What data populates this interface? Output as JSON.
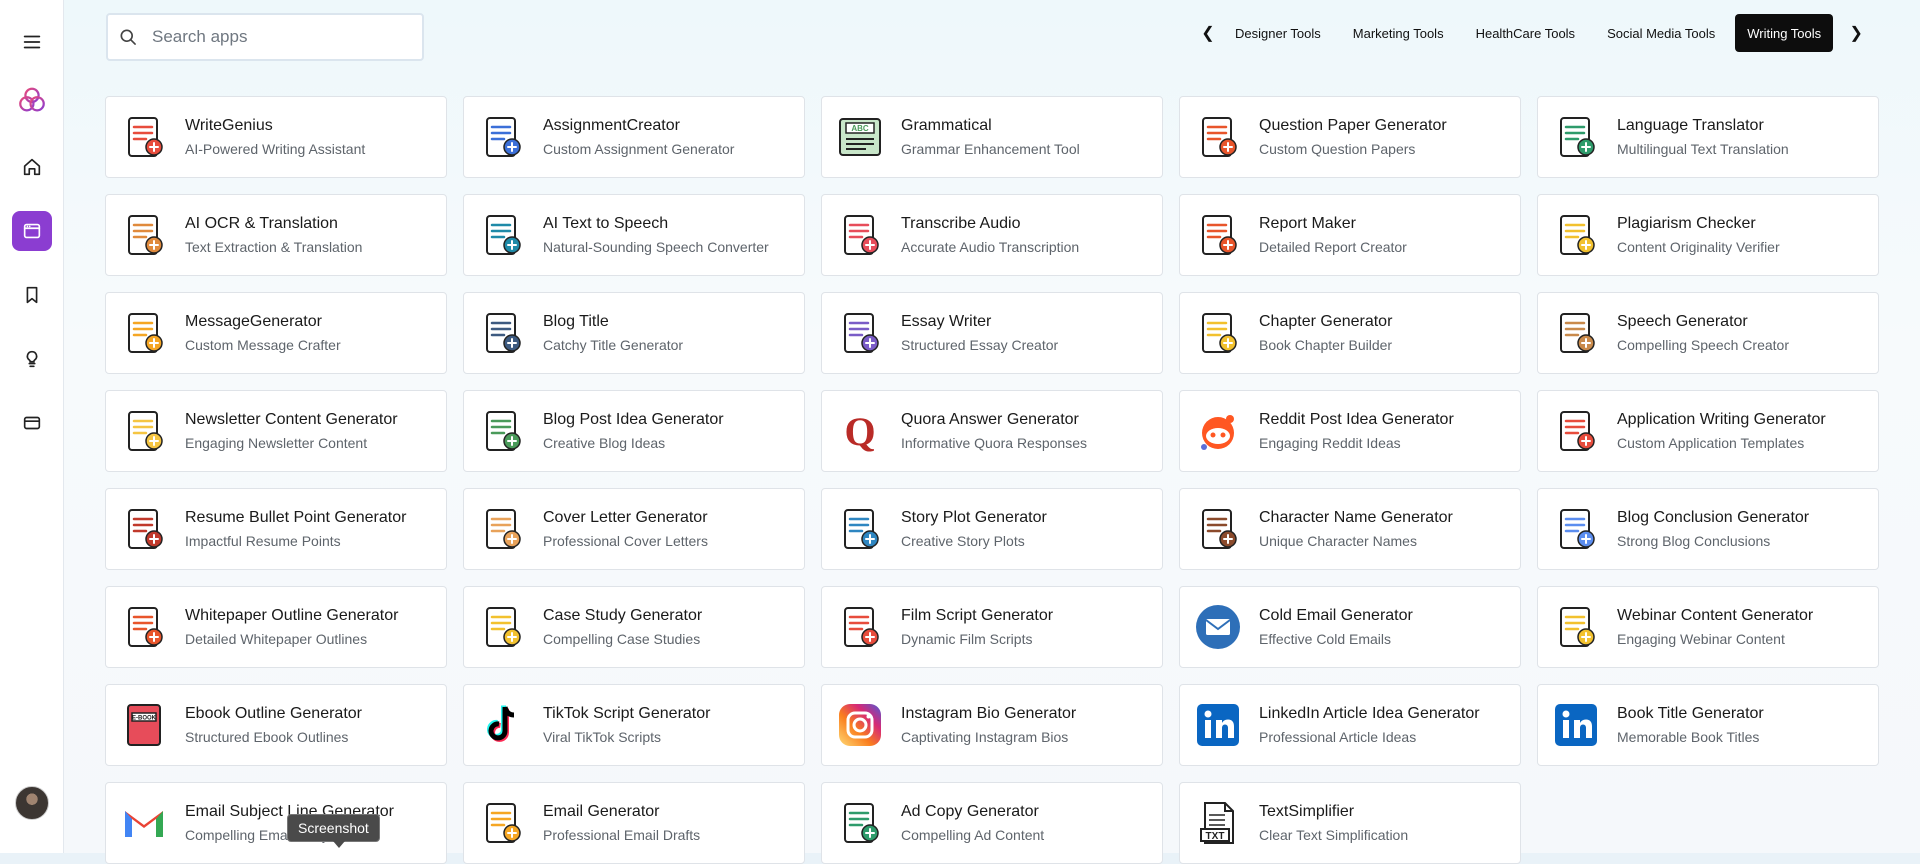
{
  "search": {
    "placeholder": "Search apps",
    "value": ""
  },
  "tabs": [
    {
      "label": "Designer Tools",
      "active": false
    },
    {
      "label": "Marketing Tools",
      "active": false
    },
    {
      "label": "HealthCare Tools",
      "active": false
    },
    {
      "label": "Social Media Tools",
      "active": false
    },
    {
      "label": "Writing Tools",
      "active": true
    }
  ],
  "sidebar": {
    "items": [
      {
        "icon": "menu-icon"
      },
      {
        "icon": "logo-icon"
      },
      {
        "icon": "home-icon"
      },
      {
        "icon": "apps-icon",
        "active": true
      },
      {
        "icon": "bookmark-icon"
      },
      {
        "icon": "lightbulb-icon"
      },
      {
        "icon": "card-icon"
      }
    ],
    "accent": "#8b3dd1"
  },
  "apps": [
    {
      "name": "WriteGenius",
      "desc": "AI-Powered Writing Assistant",
      "icon": "writer-icon",
      "color": "#e74c3c"
    },
    {
      "name": "AssignmentCreator",
      "desc": "Custom Assignment Generator",
      "icon": "student-icon",
      "color": "#3b6fd8"
    },
    {
      "name": "Grammatical",
      "desc": "Grammar Enhancement Tool",
      "icon": "abc-book-icon",
      "color": "#4a9a5a"
    },
    {
      "name": "Question Paper Generator",
      "desc": "Custom Question Papers",
      "icon": "exam-icon",
      "color": "#e8552b"
    },
    {
      "name": "Language Translator",
      "desc": "Multilingual Text Translation",
      "icon": "translate-globe-icon",
      "color": "#2e9b6b"
    },
    {
      "name": "AI OCR & Translation",
      "desc": "Text Extraction & Translation",
      "icon": "image-stack-icon",
      "color": "#e08a3c"
    },
    {
      "name": "AI Text to Speech",
      "desc": "Natural-Sounding Speech Converter",
      "icon": "audio-doc-icon",
      "color": "#1e8aa8"
    },
    {
      "name": "Transcribe Audio",
      "desc": "Accurate Audio Transcription",
      "icon": "translate-letters-icon",
      "color": "#e74c5a"
    },
    {
      "name": "Report Maker",
      "desc": "Detailed Report Creator",
      "icon": "report-chart-icon",
      "color": "#e8552b"
    },
    {
      "name": "Plagiarism Checker",
      "desc": "Content Originality Verifier",
      "icon": "plagiarism-icon",
      "color": "#f2c12e"
    },
    {
      "name": "MessageGenerator",
      "desc": "Custom Message Crafter",
      "icon": "message-alert-icon",
      "color": "#f5a623"
    },
    {
      "name": "Blog Title",
      "desc": "Catchy Title Generator",
      "icon": "blog-page-icon",
      "color": "#3d5a80"
    },
    {
      "name": "Essay Writer",
      "desc": "Structured Essay Creator",
      "icon": "essay-icon",
      "color": "#7a5cc7"
    },
    {
      "name": "Chapter Generator",
      "desc": "Book Chapter Builder",
      "icon": "chapter-list-icon",
      "color": "#f2c12e"
    },
    {
      "name": "Speech Generator",
      "desc": "Compelling Speech Creator",
      "icon": "podium-icon",
      "color": "#c98a4b"
    },
    {
      "name": "Newsletter Content Generator",
      "desc": "Engaging Newsletter Content",
      "icon": "newsletter-icon",
      "color": "#f5c542"
    },
    {
      "name": "Blog Post Idea Generator",
      "desc": "Creative Blog Ideas",
      "icon": "blog-screen-icon",
      "color": "#4a9a5a"
    },
    {
      "name": "Quora Answer Generator",
      "desc": "Informative Quora Responses",
      "icon": "quora-icon",
      "color": "#b92b27"
    },
    {
      "name": "Reddit Post Idea Generator",
      "desc": "Engaging Reddit Ideas",
      "icon": "reddit-icon",
      "color": "#ff5722"
    },
    {
      "name": "Application Writing Generator",
      "desc": "Custom Application Templates",
      "icon": "application-icon",
      "color": "#e74c3c"
    },
    {
      "name": "Resume Bullet Point Generator",
      "desc": "Impactful Resume Points",
      "icon": "resume-icon",
      "color": "#c0392b"
    },
    {
      "name": "Cover Letter Generator",
      "desc": "Professional Cover Letters",
      "icon": "cover-letter-icon",
      "color": "#e8a25a"
    },
    {
      "name": "Story Plot Generator",
      "desc": "Creative Story Plots",
      "icon": "open-book-icon",
      "color": "#2e86c1"
    },
    {
      "name": "Character Name Generator",
      "desc": "Unique Character Names",
      "icon": "bearded-man-icon",
      "color": "#8b4a2b"
    },
    {
      "name": "Blog Conclusion Generator",
      "desc": "Strong Blog Conclusions",
      "icon": "blog-conclusion-icon",
      "color": "#5b8def"
    },
    {
      "name": "Whitepaper Outline Generator",
      "desc": "Detailed Whitepaper Outlines",
      "icon": "pencil-scribble-icon",
      "color": "#e8552b"
    },
    {
      "name": "Case Study Generator",
      "desc": "Compelling Case Studies",
      "icon": "case-study-icon",
      "color": "#f2c12e"
    },
    {
      "name": "Film Script Generator",
      "desc": "Dynamic Film Scripts",
      "icon": "film-script-icon",
      "color": "#e74c3c"
    },
    {
      "name": "Cold Email Generator",
      "desc": "Effective Cold Emails",
      "icon": "envelope-circle-icon",
      "color": "#2e6fb8"
    },
    {
      "name": "Webinar Content Generator",
      "desc": "Engaging Webinar Content",
      "icon": "webinar-icon",
      "color": "#f2c12e"
    },
    {
      "name": "Ebook Outline Generator",
      "desc": "Structured Ebook Outlines",
      "icon": "ebook-icon",
      "color": "#e74c5a"
    },
    {
      "name": "TikTok Script Generator",
      "desc": "Viral TikTok Scripts",
      "icon": "tiktok-icon",
      "color": "#000000"
    },
    {
      "name": "Instagram Bio Generator",
      "desc": "Captivating Instagram Bios",
      "icon": "instagram-icon",
      "color": "#e1306c"
    },
    {
      "name": "LinkedIn Article Idea Generator",
      "desc": "Professional Article Ideas",
      "icon": "linkedin-icon",
      "color": "#0a66c2"
    },
    {
      "name": "Book Title Generator",
      "desc": "Memorable Book Titles",
      "icon": "linkedin-icon",
      "color": "#0a66c2"
    },
    {
      "name": "Email Subject Line Generator",
      "desc": "Compelling Email Subjects",
      "icon": "gmail-icon",
      "color": "#ea4335"
    },
    {
      "name": "Email Generator",
      "desc": "Professional Email Drafts",
      "icon": "paper-plane-mail-icon",
      "color": "#f5a623"
    },
    {
      "name": "Ad Copy Generator",
      "desc": "Compelling Ad Content",
      "icon": "shield-clipboard-icon",
      "color": "#2e9b6b"
    },
    {
      "name": "TextSimplifier",
      "desc": "Clear Text Simplification",
      "icon": "txt-file-icon",
      "color": "#222222"
    }
  ],
  "tooltip": {
    "text": "Screenshot"
  }
}
